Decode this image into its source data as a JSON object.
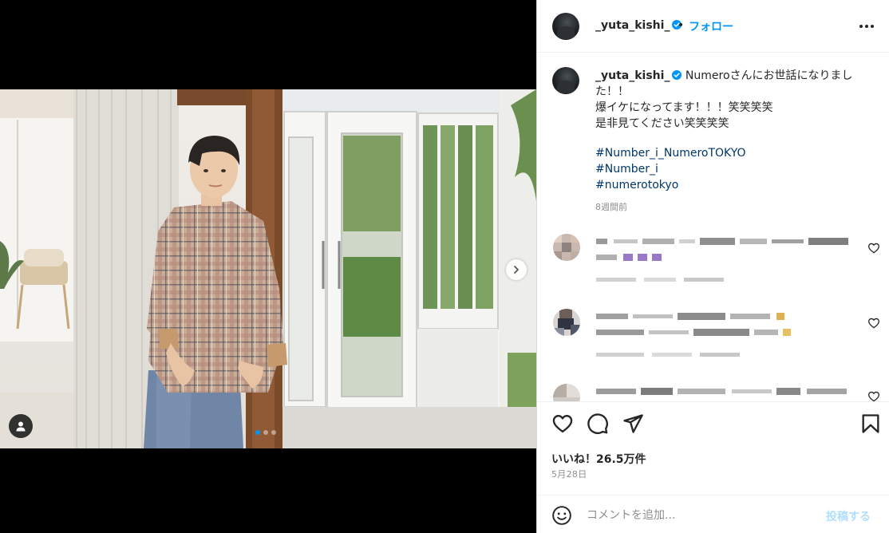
{
  "post": {
    "username": "_yuta_kishi_",
    "separator": "•",
    "follow_label": "フォロー",
    "caption": {
      "line1": "Numeroさんにお世話になりまし",
      "line2": "た！！",
      "line3": "爆イケになってます！！！笑笑笑笑",
      "line4": "是非見てください笑笑笑笑",
      "hashtags": [
        "#Number_i_NumeroTOKYO",
        "#Number_i",
        "#numerotokyo"
      ],
      "time": "8週間前"
    },
    "likes_label": "いいね！26.5万件",
    "date": "5月28日"
  },
  "comment_box": {
    "placeholder": "コメントを追加...",
    "post_label": "投稿する"
  },
  "colors": {
    "accent": "#0095f6",
    "hashtag": "#00376b",
    "muted": "#8e8e8e",
    "border": "#dbdbdb",
    "post_disabled": "#b2dffc"
  },
  "icons": {
    "verified": "verified-badge-icon",
    "more": "more-horizontal-icon",
    "heart": "heart-icon",
    "comment": "comment-bubble-icon",
    "share": "paper-plane-icon",
    "save": "bookmark-icon",
    "emoji": "smiley-icon",
    "next": "chevron-right-icon",
    "tagged": "user-tag-icon"
  },
  "carousel": {
    "count": 3,
    "active": 1
  }
}
